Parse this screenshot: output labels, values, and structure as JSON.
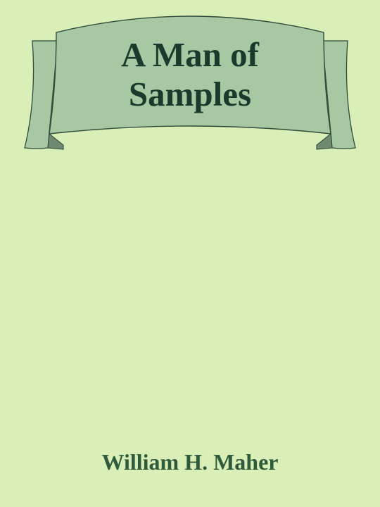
{
  "book": {
    "title_lines": [
      "A Man of",
      "Samples"
    ],
    "author": "William H. Maher"
  },
  "colors": {
    "background": "#d9efb7",
    "banner_fill": "#a8c8a4",
    "banner_shadow": "#6f8a70",
    "banner_outline": "#2f4a3a",
    "title_text": "#1c3a2c",
    "author_text": "#2f5a3c"
  }
}
